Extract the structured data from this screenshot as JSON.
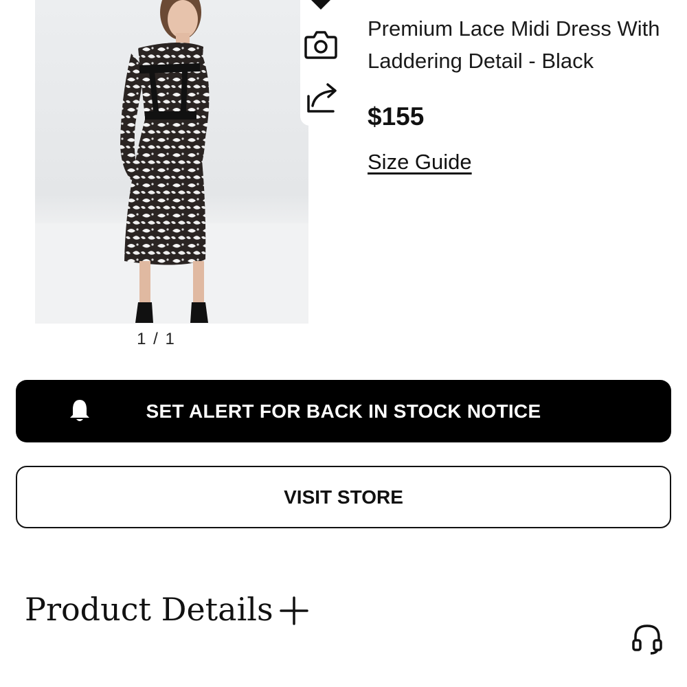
{
  "product": {
    "image_alt": "Premium Lace Midi Dress With Laddering Detail - Black",
    "image_counter": "1 / 1",
    "title": "Premium Lace Midi Dress With Laddering Detail - Black",
    "price": "$155",
    "size_guide_label": "Size Guide"
  },
  "actions": {
    "alert_label": "SET ALERT FOR BACK IN STOCK NOTICE",
    "visit_store_label": "VISIT STORE"
  },
  "details": {
    "heading": "Product Details"
  },
  "icons": {
    "favorite": "heart-icon",
    "camera": "camera-icon",
    "share": "share-icon",
    "alert": "bell-icon",
    "expand": "plus-icon",
    "support": "headset-icon"
  },
  "colors": {
    "primary_button_bg": "#000000",
    "primary_button_text": "#ffffff",
    "outline_border": "#111111"
  }
}
